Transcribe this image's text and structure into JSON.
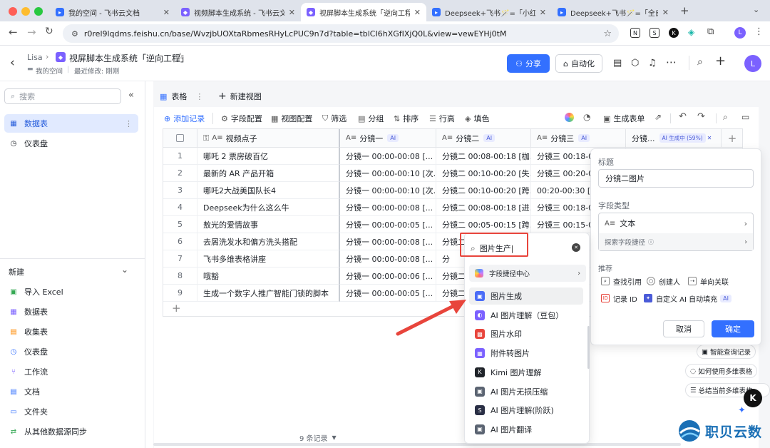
{
  "browser": {
    "tabs": [
      {
        "title": "我的空间 - 飞书云文档",
        "fav_color": "#3370ff"
      },
      {
        "title": "视频脚本生成系统 - 飞书云文档",
        "fav_color": "#7b61ff"
      },
      {
        "title": "视屏脚本生成系统「逆向工程」",
        "fav_color": "#7b61ff"
      },
      {
        "title": "Deepseek+飞书🪄=「小红书",
        "fav_color": "#3370ff"
      },
      {
        "title": "Deepseek+飞书🪄=「全自动",
        "fav_color": "#3370ff"
      }
    ],
    "url": "r0rel9lqdms.feishu.cn/base/WvzjbUOXtaRbmesRHyLcPUC9n7d?table=tblCI6hXGfIXjQ0L&view=vewEYHj0tM",
    "profile_letter": "L"
  },
  "header": {
    "breadcrumb_user": "Lisa",
    "doc_title": "视屏脚本生成系统「逆向工程」",
    "location": "我的空间",
    "last_modified": "最近修改: 刚刚",
    "share_label": "分享",
    "automation_label": "自动化",
    "avatar_letter": "L"
  },
  "sidebar": {
    "search_placeholder": "搜索",
    "items": [
      {
        "label": "数据表",
        "icon": "table-icon"
      },
      {
        "label": "仪表盘",
        "icon": "dashboard-icon"
      }
    ],
    "new_label": "新建",
    "new_items": [
      {
        "label": "导入 Excel",
        "icon": "excel-icon"
      },
      {
        "label": "数据表",
        "icon": "table-icon"
      },
      {
        "label": "收集表",
        "icon": "form-icon"
      },
      {
        "label": "仪表盘",
        "icon": "dashboard-icon"
      },
      {
        "label": "工作流",
        "icon": "workflow-icon"
      },
      {
        "label": "文档",
        "icon": "doc-icon"
      },
      {
        "label": "文件夹",
        "icon": "folder-icon"
      },
      {
        "label": "从其他数据源同步",
        "icon": "sync-icon"
      }
    ]
  },
  "views": {
    "active_view": "表格",
    "new_view": "新建视图"
  },
  "toolbar": {
    "add_record": "添加记录",
    "field_config": "字段配置",
    "view_config": "视图配置",
    "filter": "筛选",
    "group": "分组",
    "sort": "排序",
    "row_height": "行高",
    "fill": "填色",
    "generate_form": "生成表单"
  },
  "table": {
    "columns": [
      "视频点子",
      "分镜一",
      "分镜二",
      "分镜三",
      "分镜..."
    ],
    "ai_tag": "AI",
    "ai_generating": "AI 生成中 (59%)",
    "rows": [
      {
        "n": "1",
        "idea": "哪吒 2 票房破百亿",
        "s1": "分镜一 00:00-00:08 [...",
        "s2": "分镜二 00:08-00:18 [枷...",
        "s3": "分镜三 00:18-00"
      },
      {
        "n": "2",
        "idea": "最新的 AR 产品开箱",
        "s1": "分镜一 00:00-00:10 [次...",
        "s2": "分镜二 00:10-00:20 [失...",
        "s3": "分镜三 00:20-00"
      },
      {
        "n": "3",
        "idea": "哪吒2大战美国队长4",
        "s1": "分镜一 00:00-00:10 [次...",
        "s2": "分镜二 00:10-00:20 [跨...",
        "s3": "00:20-00:30 [文"
      },
      {
        "n": "4",
        "idea": "Deepseek为什么这么牛",
        "s1": "分镜一 00:00-00:08 [...",
        "s2": "分镜二 00:08-00:18 [进...",
        "s3": "分镜三 00:18-00"
      },
      {
        "n": "5",
        "idea": "敖光的爱情故事",
        "s1": "分镜一 00:00-00:05 [...",
        "s2": "分镜二 00:05-00:15 [跨...",
        "s3": "分镜三 00:15-00"
      },
      {
        "n": "6",
        "idea": "去屑洗发水和偏方洗头搭配",
        "s1": "分镜一 00:00-00:08 [...",
        "s2": "分镜二",
        "s3": ""
      },
      {
        "n": "7",
        "idea": "飞书多维表格讲座",
        "s1": "分镜一 00:00-00:08 [...",
        "s2": "分",
        "s3": ""
      },
      {
        "n": "8",
        "idea": "哦豁",
        "s1": "分镜一 00:00-00:06 [...",
        "s2": "分镜二",
        "s3": ""
      },
      {
        "n": "9",
        "idea": "生成一个数字人推广智能门锁的脚本",
        "s1": "分镜一 00:00-00:05 [...",
        "s2": "分镜二",
        "s3": ""
      }
    ],
    "record_count": "9 条记录"
  },
  "dropdown": {
    "search_value": "图片生产",
    "shortcut_center": "字段捷径中心",
    "items": [
      {
        "label": "图片生成",
        "color": "#4a6cf7"
      },
      {
        "label": "AI 图片理解（豆包）",
        "color": "#7b61ff"
      },
      {
        "label": "图片水印",
        "color": "#e8453c"
      },
      {
        "label": "附件转图片",
        "color": "#7b61ff"
      },
      {
        "label": "Kimi 图片理解",
        "color": "#1f2329"
      },
      {
        "label": "AI 图片无损压缩",
        "color": "#5b6472"
      },
      {
        "label": "AI 图片理解(阶跃)",
        "color": "#2a2f45"
      },
      {
        "label": "AI 图片翻译",
        "color": "#5b6472"
      }
    ]
  },
  "panel": {
    "title_label": "标题",
    "title_value": "分镜二图片",
    "field_type_label": "字段类型",
    "field_type_value": "文本",
    "search_shortcut": "探索字段捷径",
    "recommend_label": "推荐",
    "chips": [
      "查找引用",
      "创建人",
      "单向关联",
      "记录 ID",
      "自定义 AI 自动填充"
    ],
    "cancel": "取消",
    "confirm": "确定"
  },
  "suggestions": [
    "智能查询记录",
    "如何使用多维表格",
    "总结当前多维表格"
  ],
  "watermark": "职贝云数"
}
